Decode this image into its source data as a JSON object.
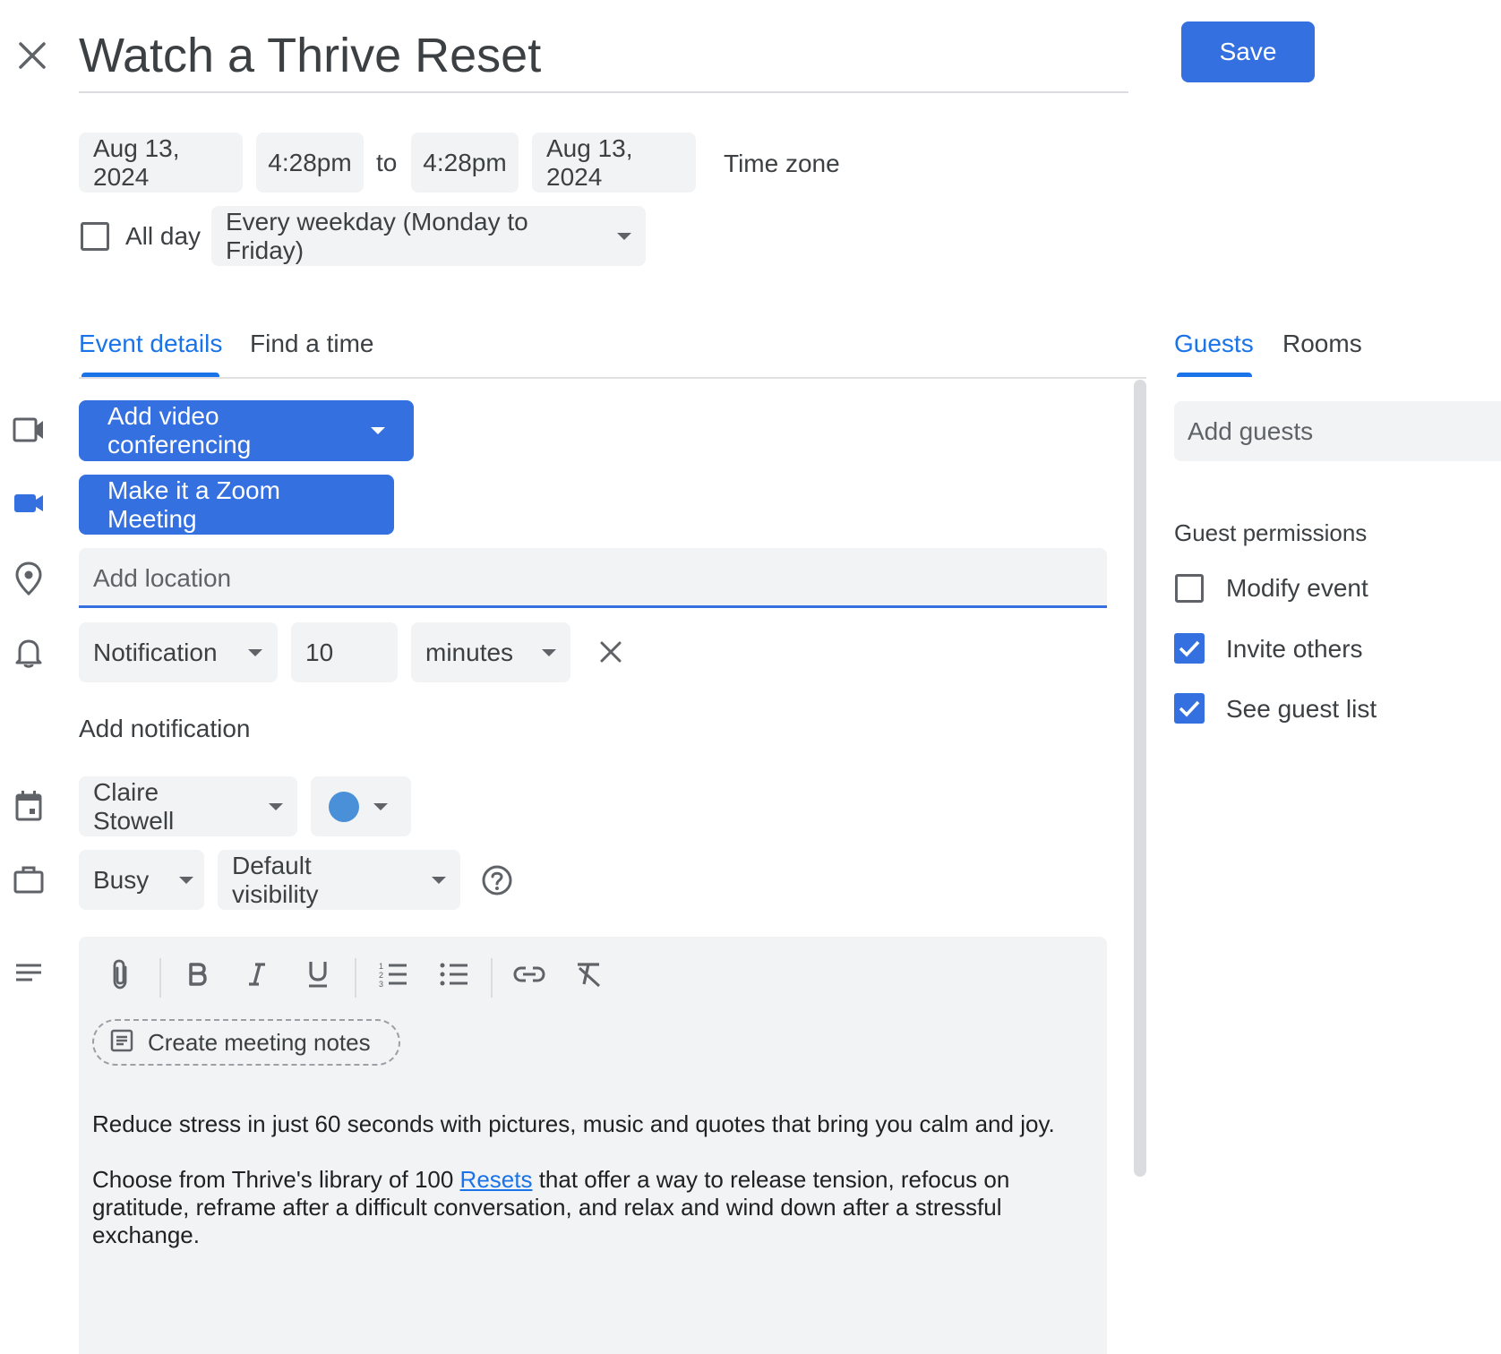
{
  "header": {
    "title": "Watch a Thrive Reset",
    "save_label": "Save"
  },
  "when": {
    "start_date": "Aug 13, 2024",
    "start_time": "4:28pm",
    "to_label": "to",
    "end_time": "4:28pm",
    "end_date": "Aug 13, 2024",
    "timezone_label": "Time zone",
    "all_day_label": "All day",
    "all_day_checked": false,
    "recurrence": "Every weekday (Monday to Friday)"
  },
  "tabs": [
    {
      "label": "Event details",
      "active": true
    },
    {
      "label": "Find a time",
      "active": false
    }
  ],
  "side_tabs": [
    {
      "label": "Guests",
      "active": true
    },
    {
      "label": "Rooms",
      "active": false
    }
  ],
  "details": {
    "video_label": "Add video conferencing",
    "zoom_label": "Make it a Zoom Meeting",
    "location_placeholder": "Add location",
    "notification": {
      "type": "Notification",
      "value": "10",
      "unit": "minutes"
    },
    "add_notification_label": "Add notification",
    "calendar_owner": "Claire Stowell",
    "event_color": "#4a90d9",
    "availability": "Busy",
    "visibility": "Default visibility",
    "meeting_notes_label": "Create meeting notes",
    "description_line1": "Reduce stress in just 60 seconds with pictures, music and quotes that bring you calm and joy.",
    "description_p2_before": "Choose from Thrive's library of 100 ",
    "description_link": "Resets",
    "description_p2_after": " that offer a way to release tension, refocus on gratitude, reframe after a difficult conversation, and relax and wind down after a stressful exchange."
  },
  "guests": {
    "add_placeholder": "Add guests",
    "permissions_title": "Guest permissions",
    "permissions": [
      {
        "label": "Modify event",
        "checked": false
      },
      {
        "label": "Invite others",
        "checked": true
      },
      {
        "label": "See guest list",
        "checked": true
      }
    ]
  },
  "colors": {
    "accent": "#1a73e8",
    "button": "#3570e0"
  }
}
